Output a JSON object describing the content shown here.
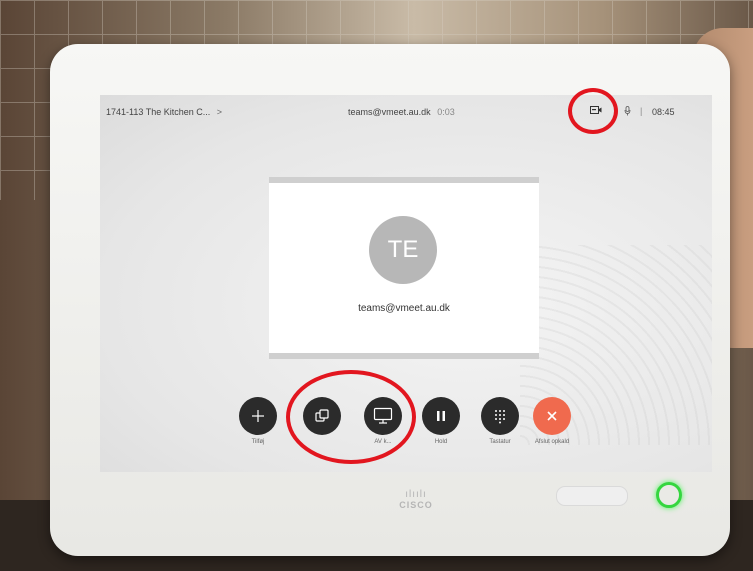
{
  "topbar": {
    "room": "1741-113 The Kitchen C...",
    "room_chevron": ">",
    "call_address": "teams@vmeet.au.dk",
    "call_timer": "0:03",
    "separator": "|",
    "clock": "08:45"
  },
  "participant": {
    "initials": "TE",
    "address": "teams@vmeet.au.dk"
  },
  "controls": [
    {
      "label": "Tilføj",
      "icon": "add-icon"
    },
    {
      "label": "",
      "icon": "layout-icon"
    },
    {
      "label": "AV k...",
      "icon": "share-screen-icon"
    },
    {
      "label": "Hold",
      "icon": "pause-icon"
    },
    {
      "label": "Tastatur",
      "icon": "keypad-icon"
    },
    {
      "label": "Afslut opkald",
      "icon": "end-call-icon"
    }
  ],
  "device": {
    "brand_bars": "ılıılı",
    "brand_word": "CISCO"
  },
  "colors": {
    "end_call": "#f06a4e",
    "annotation": "#e2161f",
    "status_led": "#35d63f"
  }
}
